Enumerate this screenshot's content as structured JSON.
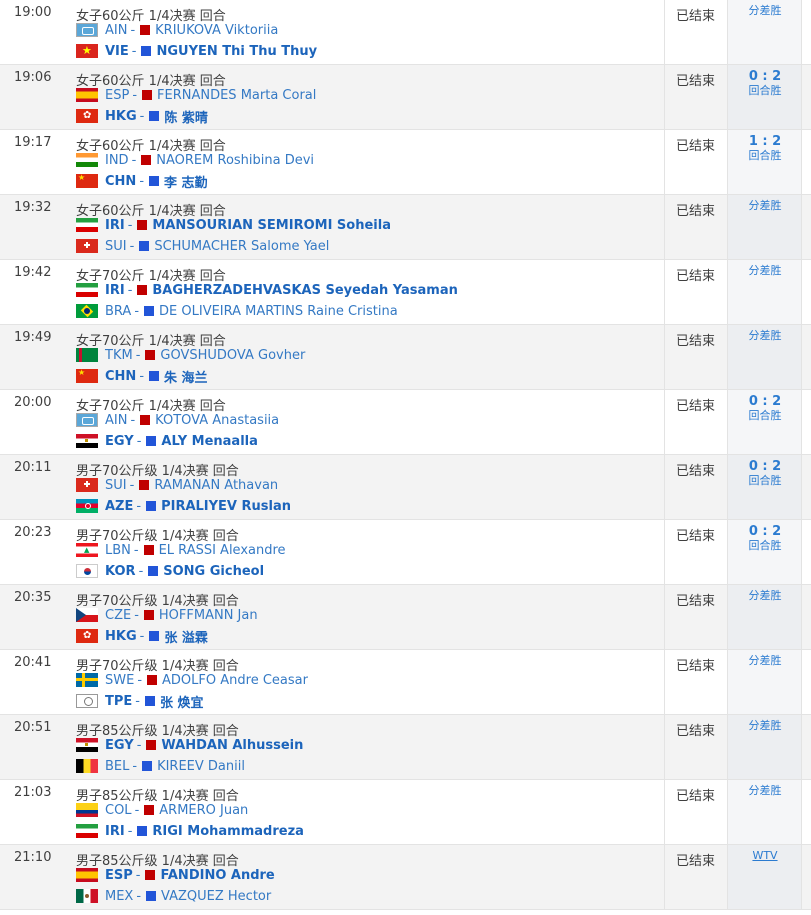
{
  "status_label": "已结束",
  "rows": [
    {
      "time": "19:00",
      "event": "女子60公斤 1/4决赛 回合",
      "result": {
        "score": "",
        "type": "分差胜"
      },
      "a1": {
        "flag": "AIN",
        "code": "AIN",
        "name": "KRIUKOVA Viktoriia",
        "winner": false
      },
      "a2": {
        "flag": "VIE",
        "code": "VIE",
        "name": "NGUYEN Thi Thu Thuy",
        "winner": true
      }
    },
    {
      "time": "19:06",
      "event": "女子60公斤 1/4决赛 回合",
      "result": {
        "score": "0 : 2",
        "type": "回合胜"
      },
      "a1": {
        "flag": "ESP",
        "code": "ESP",
        "name": "FERNANDES Marta Coral",
        "winner": false
      },
      "a2": {
        "flag": "HKG",
        "code": "HKG",
        "name": "陈 紫晴",
        "winner": true
      }
    },
    {
      "time": "19:17",
      "event": "女子60公斤 1/4决赛 回合",
      "result": {
        "score": "1 : 2",
        "type": "回合胜"
      },
      "a1": {
        "flag": "IND",
        "code": "IND",
        "name": "NAOREM Roshibina Devi",
        "winner": false
      },
      "a2": {
        "flag": "CHN",
        "code": "CHN",
        "name": "李 志勤",
        "winner": true
      }
    },
    {
      "time": "19:32",
      "event": "女子60公斤 1/4决赛 回合",
      "result": {
        "score": "",
        "type": "分差胜"
      },
      "a1": {
        "flag": "IRI",
        "code": "IRI",
        "name": "MANSOURIAN SEMIROMI Soheila",
        "winner": true
      },
      "a2": {
        "flag": "SUI",
        "code": "SUI",
        "name": "SCHUMACHER Salome Yael",
        "winner": false
      }
    },
    {
      "time": "19:42",
      "event": "女子70公斤 1/4决赛 回合",
      "result": {
        "score": "",
        "type": "分差胜"
      },
      "a1": {
        "flag": "IRI",
        "code": "IRI",
        "name": "BAGHERZADEHVASKAS Seyedah Yasaman",
        "winner": true
      },
      "a2": {
        "flag": "BRA",
        "code": "BRA",
        "name": "DE OLIVEIRA MARTINS Raine Cristina",
        "winner": false
      }
    },
    {
      "time": "19:49",
      "event": "女子70公斤 1/4决赛 回合",
      "result": {
        "score": "",
        "type": "分差胜"
      },
      "a1": {
        "flag": "TKM",
        "code": "TKM",
        "name": "GOVSHUDOVA Govher",
        "winner": false
      },
      "a2": {
        "flag": "CHN",
        "code": "CHN",
        "name": "朱 海兰",
        "winner": true
      }
    },
    {
      "time": "20:00",
      "event": "女子70公斤 1/4决赛 回合",
      "result": {
        "score": "0 : 2",
        "type": "回合胜"
      },
      "a1": {
        "flag": "AIN",
        "code": "AIN",
        "name": "KOTOVA Anastasiia",
        "winner": false
      },
      "a2": {
        "flag": "EGY",
        "code": "EGY",
        "name": "ALY Menaalla",
        "winner": true
      }
    },
    {
      "time": "20:11",
      "event": "男子70公斤级 1/4决赛 回合",
      "result": {
        "score": "0 : 2",
        "type": "回合胜"
      },
      "a1": {
        "flag": "SUI",
        "code": "SUI",
        "name": "RAMANAN Athavan",
        "winner": false
      },
      "a2": {
        "flag": "AZE",
        "code": "AZE",
        "name": "PIRALIYEV Ruslan",
        "winner": true
      }
    },
    {
      "time": "20:23",
      "event": "男子70公斤级 1/4决赛 回合",
      "result": {
        "score": "0 : 2",
        "type": "回合胜"
      },
      "a1": {
        "flag": "LBN",
        "code": "LBN",
        "name": "EL RASSI Alexandre",
        "winner": false
      },
      "a2": {
        "flag": "KOR",
        "code": "KOR",
        "name": "SONG Gicheol",
        "winner": true
      }
    },
    {
      "time": "20:35",
      "event": "男子70公斤级 1/4决赛 回合",
      "result": {
        "score": "",
        "type": "分差胜"
      },
      "a1": {
        "flag": "CZE",
        "code": "CZE",
        "name": "HOFFMANN Jan",
        "winner": false
      },
      "a2": {
        "flag": "HKG",
        "code": "HKG",
        "name": "张 溢霖",
        "winner": true
      }
    },
    {
      "time": "20:41",
      "event": "男子70公斤级 1/4决赛 回合",
      "result": {
        "score": "",
        "type": "分差胜"
      },
      "a1": {
        "flag": "SWE",
        "code": "SWE",
        "name": "ADOLFO Andre Ceasar",
        "winner": false
      },
      "a2": {
        "flag": "TPE",
        "code": "TPE",
        "name": "张 焕宜",
        "winner": true
      }
    },
    {
      "time": "20:51",
      "event": "男子85公斤级 1/4决赛 回合",
      "result": {
        "score": "",
        "type": "分差胜"
      },
      "a1": {
        "flag": "EGY",
        "code": "EGY",
        "name": "WAHDAN Alhussein",
        "winner": true
      },
      "a2": {
        "flag": "BEL",
        "code": "BEL",
        "name": "KIREEV Daniil",
        "winner": false
      }
    },
    {
      "time": "21:03",
      "event": "男子85公斤级 1/4决赛 回合",
      "result": {
        "score": "",
        "type": "分差胜"
      },
      "a1": {
        "flag": "COL",
        "code": "COL",
        "name": "ARMERO Juan",
        "winner": false
      },
      "a2": {
        "flag": "IRI",
        "code": "IRI",
        "name": "RIGI Mohammadreza",
        "winner": true
      }
    },
    {
      "time": "21:10",
      "event": "男子85公斤级 1/4决赛 回合",
      "result": {
        "score": "",
        "type": "WTV"
      },
      "a1": {
        "flag": "ESP",
        "code": "ESP",
        "name": "FANDINO Andre",
        "winner": true
      },
      "a2": {
        "flag": "MEX",
        "code": "MEX",
        "name": "VAZQUEZ Hector",
        "winner": false
      }
    }
  ]
}
